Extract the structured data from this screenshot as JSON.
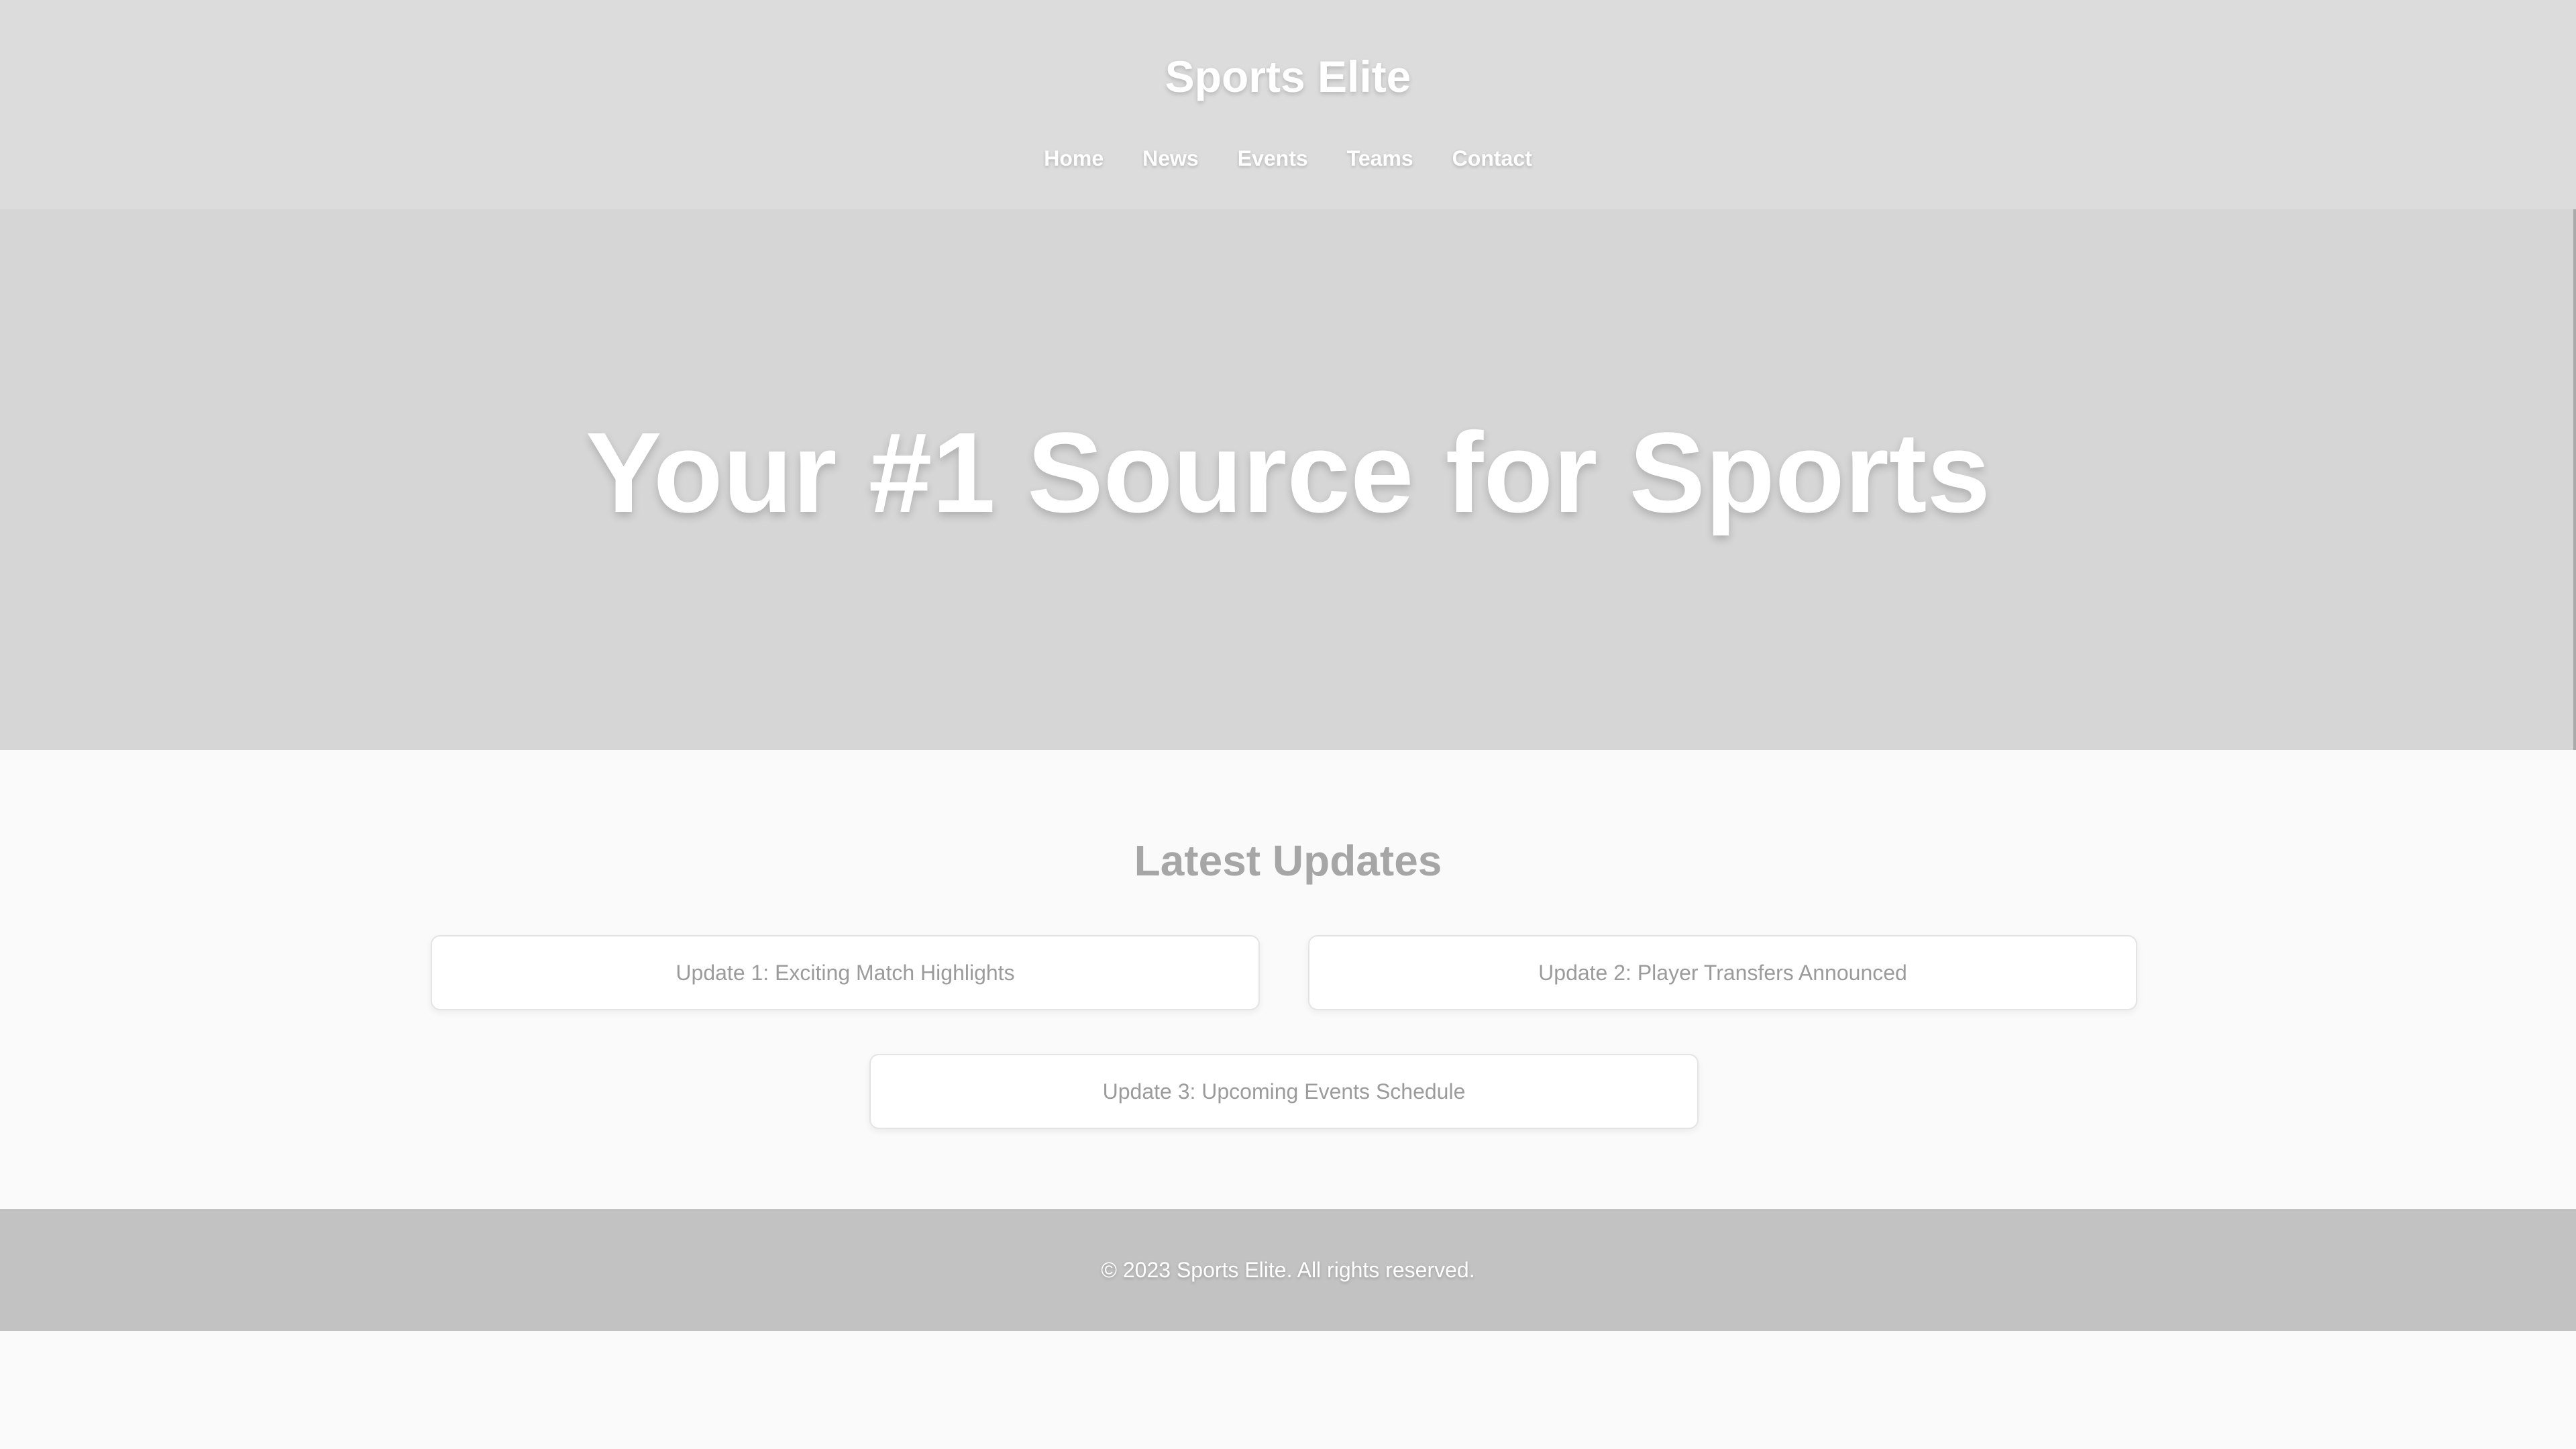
{
  "header": {
    "brand": "Sports Elite",
    "nav": {
      "home": "Home",
      "news": "News",
      "events": "Events",
      "teams": "Teams",
      "contact": "Contact"
    }
  },
  "hero": {
    "title": "Your #1 Source for Sports"
  },
  "updates": {
    "title": "Latest Updates",
    "items": [
      "Update 1: Exciting Match Highlights",
      "Update 2: Player Transfers Announced",
      "Update 3: Upcoming Events Schedule"
    ]
  },
  "footer": {
    "copyright": "© 2023 Sports Elite. All rights reserved."
  }
}
